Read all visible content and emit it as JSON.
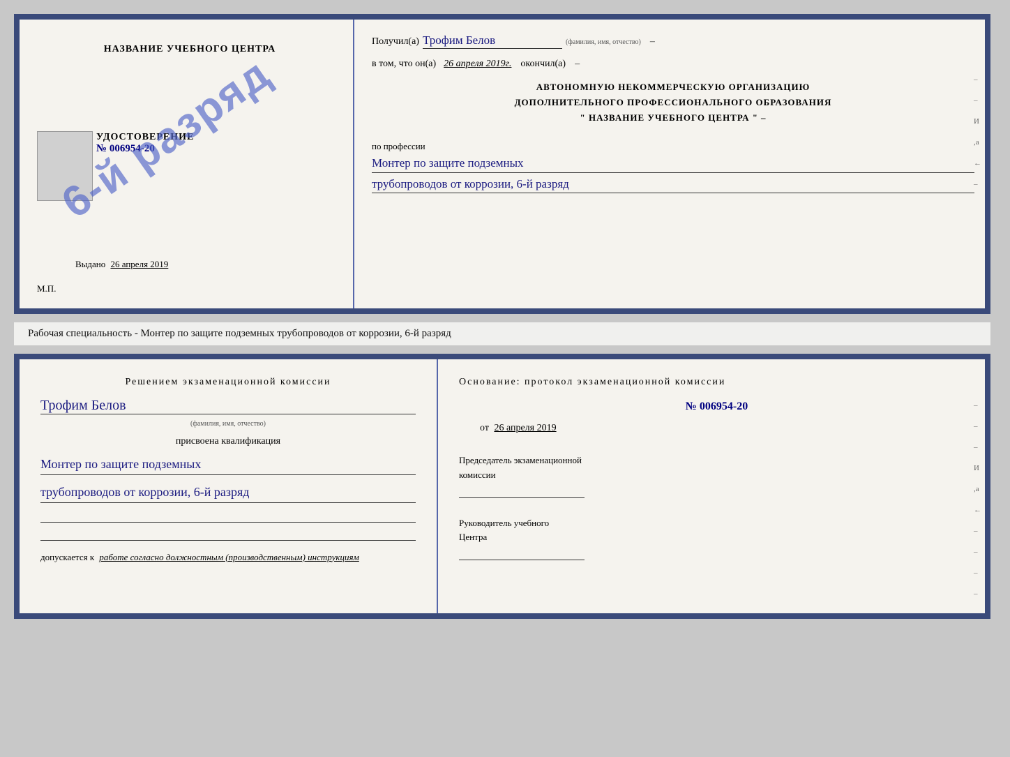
{
  "page": {
    "background": "#c8c8c8"
  },
  "diploma": {
    "left": {
      "title": "НАЗВАНИЕ УЧЕБНОГО ЦЕНТРА",
      "stamp_text": "6-й разряд",
      "udost_title": "УДОСТОВЕРЕНИЕ",
      "udost_number": "№ 006954-20",
      "vydano_label": "Выдано",
      "vydano_date": "26 апреля 2019",
      "mp_label": "М.П."
    },
    "right": {
      "poluchil_label": "Получил(а)",
      "name_handwritten": "Трофим Белов",
      "name_subtext": "(фамилия, имя, отчество)",
      "dash1": "–",
      "vtom_label": "в том, что он(а)",
      "date_handwritten": "26 апреля 2019г.",
      "okonchil_label": "окончил(а)",
      "dash2": "–",
      "org_line1": "АВТОНОМНУЮ НЕКОММЕРЧЕСКУЮ ОРГАНИЗАЦИЮ",
      "org_line2": "ДОПОЛНИТЕЛЬНОГО ПРОФЕССИОНАЛЬНОГО ОБРАЗОВАНИЯ",
      "org_line3": "\" НАЗВАНИЕ УЧЕБНОГО ЦЕНТРА \"",
      "dash3": "–",
      "right_edge_chars": [
        "–",
        "–",
        "И",
        ",а",
        "←",
        "–"
      ],
      "po_professii": "по профессии",
      "qualification_line1": "Монтер по защите подземных",
      "qualification_line2": "трубопроводов от коррозии, 6-й разряд"
    }
  },
  "specialty_line": {
    "text": "Рабочая специальность - Монтер по защите подземных трубопроводов от коррозии, 6-й разряд"
  },
  "certificate": {
    "left": {
      "title": "Решением экзаменационной комиссии",
      "name_handwritten": "Трофим Белов",
      "name_subtext": "(фамилия, имя, отчество)",
      "prisvoena_label": "присвоена квалификация",
      "qualification_line1": "Монтер по защите подземных",
      "qualification_line2": "трубопроводов от коррозии, 6-й разряд",
      "dopuskaetsya_label": "допускается к",
      "dopuskaetsya_text": "работе согласно должностным (производственным) инструкциям"
    },
    "right": {
      "title": "Основание: протокол экзаменационной комиссии",
      "protocol_number": "№ 006954-20",
      "date_prefix": "от",
      "date_value": "26 апреля 2019",
      "predsedatel_line1": "Председатель экзаменационной",
      "predsedatel_line2": "комиссии",
      "rukovoditel_line1": "Руководитель учебного",
      "rukovoditel_line2": "Центра",
      "right_edge_chars": [
        "–",
        "–",
        "–",
        "И",
        ",а",
        "←",
        "–",
        "–",
        "–",
        "–"
      ]
    }
  }
}
